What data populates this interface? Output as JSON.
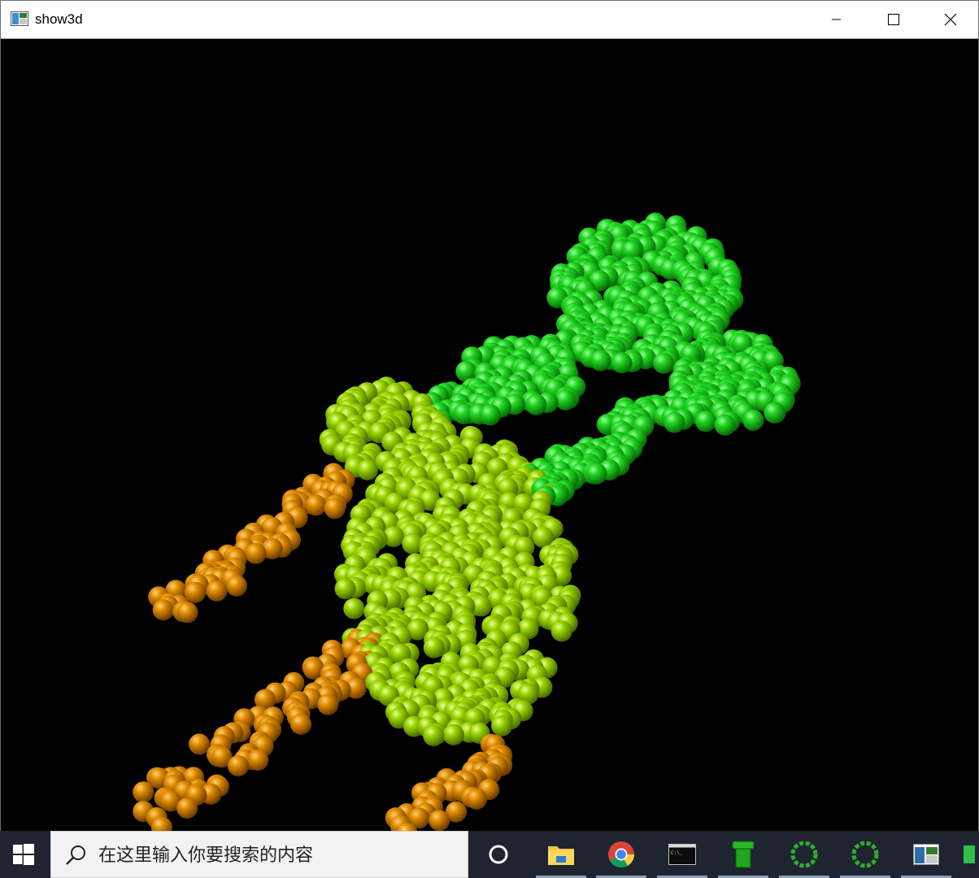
{
  "window": {
    "title": "show3d",
    "buttons": {
      "minimize": "minimize",
      "maximize": "maximize",
      "close": "close"
    }
  },
  "viewport": {
    "description_icon": "3d-render-icon",
    "colors": {
      "green": "#18c818",
      "lime": "#8fd000",
      "orange": "#e08c00",
      "background": "#000000"
    }
  },
  "taskbar": {
    "search": {
      "placeholder": "在这里输入你要搜索的内容"
    },
    "items": [
      {
        "name": "cortana-icon"
      },
      {
        "name": "file-explorer-icon"
      },
      {
        "name": "chrome-icon"
      },
      {
        "name": "terminal-icon"
      },
      {
        "name": "pipe-app-icon"
      },
      {
        "name": "loading-ring-icon"
      },
      {
        "name": "loading-ring-icon"
      },
      {
        "name": "window-app-icon"
      }
    ]
  }
}
